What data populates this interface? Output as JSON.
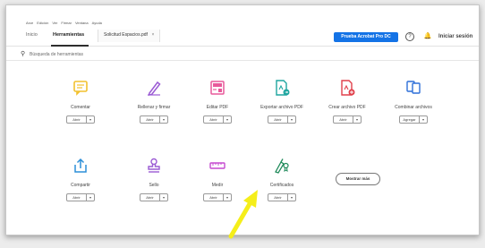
{
  "menu": [
    "Arce",
    "Edición",
    "Ver",
    "Firmar",
    "Ventana",
    "Ayuda"
  ],
  "tabs": {
    "home": "Inicio",
    "tools": "Herramientas",
    "document": "Solicitud Espacios.pdf",
    "document_close": "×"
  },
  "header": {
    "trial_button": "Prueba Acrobat Pro DC",
    "help": "?",
    "signin": "Iniciar sesión"
  },
  "search": {
    "placeholder": "Búsqueda de herramientas"
  },
  "tools": [
    {
      "label": "Comentar",
      "button": "Abrir",
      "caret": "▾",
      "icon": "comment-icon",
      "color": "#f2c12e"
    },
    {
      "label": "Rellenar y firmar",
      "button": "Abrir",
      "caret": "▾",
      "icon": "fill-sign-icon",
      "color": "#9b5bd4"
    },
    {
      "label": "Editar PDF",
      "button": "Abrir",
      "caret": "▾",
      "icon": "edit-pdf-icon",
      "color": "#e85a9b"
    },
    {
      "label": "Exportar archivo PDF",
      "button": "Abrir",
      "caret": "▾",
      "icon": "export-pdf-icon",
      "color": "#1fa6a0"
    },
    {
      "label": "Crear archivo PDF",
      "button": "Abrir",
      "caret": "▾",
      "icon": "create-pdf-icon",
      "color": "#e0404b"
    },
    {
      "label": "Combinar archivos",
      "button": "Agregar",
      "caret": "▾",
      "icon": "combine-files-icon",
      "color": "#2d6fd8"
    },
    {
      "label": "Compartir",
      "button": "Abrir",
      "caret": "▾",
      "icon": "share-icon",
      "color": "#2d8fd8"
    },
    {
      "label": "Sello",
      "button": "Abrir",
      "caret": "▾",
      "icon": "stamp-icon",
      "color": "#9b5bd4"
    },
    {
      "label": "Medir",
      "button": "Abrir",
      "caret": "▾",
      "icon": "measure-icon",
      "color": "#c54bd0"
    },
    {
      "label": "Certificados",
      "button": "Abrir",
      "caret": "▾",
      "icon": "certificates-icon",
      "color": "#1f8a5a"
    }
  ],
  "show_more": "Mostrar más",
  "annotation": {
    "icon": "pointer-arrow-icon",
    "color": "#f5ee1a"
  }
}
